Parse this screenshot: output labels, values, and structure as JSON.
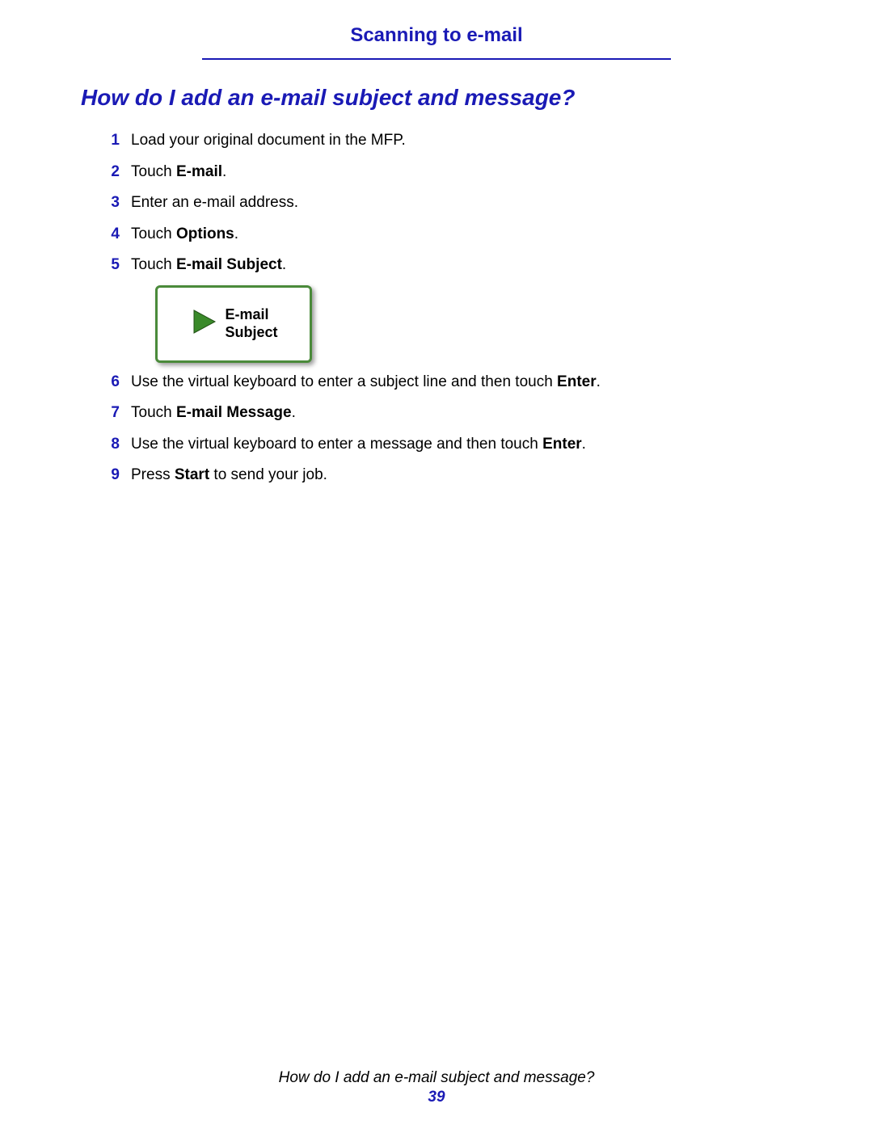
{
  "header": {
    "title": "Scanning to e-mail"
  },
  "section": {
    "title": "How do I add an e-mail subject and message?"
  },
  "steps": {
    "s1": {
      "num": "1",
      "text": "Load your original document in the MFP."
    },
    "s2": {
      "num": "2",
      "prefix": "Touch ",
      "bold": "E-mail",
      "suffix": "."
    },
    "s3": {
      "num": "3",
      "text": "Enter an e-mail address."
    },
    "s4": {
      "num": "4",
      "prefix": "Touch ",
      "bold": "Options",
      "suffix": "."
    },
    "s5": {
      "num": "5",
      "prefix": "Touch ",
      "bold": "E-mail Subject",
      "suffix": "."
    },
    "s6": {
      "num": "6",
      "prefix": "Use the virtual keyboard to enter a subject line and then touch ",
      "bold": "Enter",
      "suffix": "."
    },
    "s7": {
      "num": "7",
      "prefix": "Touch ",
      "bold": "E-mail Message",
      "suffix": "."
    },
    "s8": {
      "num": "8",
      "prefix": "Use the virtual keyboard to enter a message and then touch ",
      "bold": "Enter",
      "suffix": "."
    },
    "s9": {
      "num": "9",
      "prefix": "Press ",
      "bold": "Start",
      "suffix": " to send your job."
    }
  },
  "button": {
    "line1": "E-mail",
    "line2": "Subject"
  },
  "footer": {
    "title": "How do I add an e-mail subject and message?",
    "page": "39"
  }
}
